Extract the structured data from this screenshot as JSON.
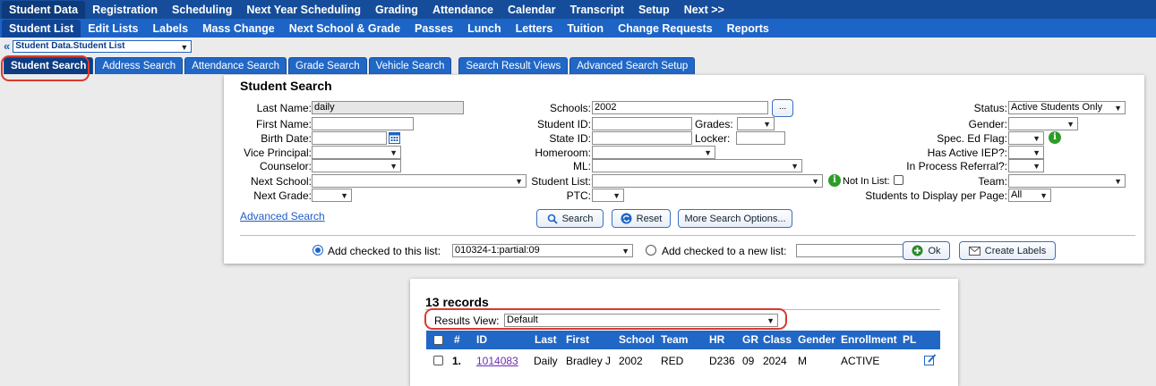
{
  "menu_primary": [
    {
      "label": "Student Data",
      "active": true
    },
    {
      "label": "Registration"
    },
    {
      "label": "Scheduling"
    },
    {
      "label": "Next Year Scheduling"
    },
    {
      "label": "Grading"
    },
    {
      "label": "Attendance"
    },
    {
      "label": "Calendar"
    },
    {
      "label": "Transcript"
    },
    {
      "label": "Setup"
    },
    {
      "label": "Next >>"
    }
  ],
  "menu_secondary": [
    {
      "label": "Student List",
      "active": true
    },
    {
      "label": "Edit Lists"
    },
    {
      "label": "Labels"
    },
    {
      "label": "Mass Change"
    },
    {
      "label": "Next School & Grade"
    },
    {
      "label": "Passes"
    },
    {
      "label": "Lunch"
    },
    {
      "label": "Letters"
    },
    {
      "label": "Tuition"
    },
    {
      "label": "Change Requests"
    },
    {
      "label": "Reports"
    }
  ],
  "breadcrumb": {
    "selected": "Student Data.Student List"
  },
  "tabs": [
    {
      "label": "Student Search",
      "active": true
    },
    {
      "label": "Address Search"
    },
    {
      "label": "Attendance Search"
    },
    {
      "label": "Grade Search"
    },
    {
      "label": "Vehicle Search"
    },
    {
      "label": "Search Result Views"
    },
    {
      "label": "Advanced Search Setup"
    }
  ],
  "search": {
    "title": "Student Search",
    "last_name_label": "Last Name:",
    "last_name_value": "daily",
    "first_name_label": "First Name:",
    "birth_date_label": "Birth Date:",
    "vice_principal_label": "Vice Principal:",
    "counselor_label": "Counselor:",
    "next_school_label": "Next School:",
    "next_grade_label": "Next Grade:",
    "schools_label": "Schools:",
    "schools_value": "2002",
    "schools_more": "...",
    "student_id_label": "Student ID:",
    "grades_label": "Grades:",
    "state_id_label": "State ID:",
    "locker_label": "Locker:",
    "homeroom_label": "Homeroom:",
    "ml_label": "ML:",
    "student_list_label": "Student List:",
    "not_in_list_label": "Not In List:",
    "ptc_label": "PTC:",
    "status_label": "Status:",
    "status_value": "Active Students Only",
    "gender_label": "Gender:",
    "sped_label": "Spec. Ed Flag:",
    "iep_label": "Has Active IEP?:",
    "referral_label": "In Process Referral?:",
    "team_label": "Team:",
    "per_page_label": "Students to Display per Page:",
    "per_page_value": "All",
    "advanced_link": "Advanced Search",
    "search_button": "Search",
    "reset_button": "Reset",
    "more_options_button": "More Search Options...",
    "add_checked_label": "Add checked to this list:",
    "add_checked_value": "010324-1:partial:09",
    "add_new_label": "Add checked to a new list:",
    "ok_button": "Ok",
    "labels_button": "Create Labels"
  },
  "results": {
    "title": "13 records",
    "view_label": "Results View:",
    "view_value": "Default",
    "columns": [
      "#",
      "ID",
      "Last",
      "First",
      "School",
      "Team",
      "HR",
      "GR",
      "Class",
      "Gender",
      "Enrollment",
      "PL"
    ],
    "rows": [
      {
        "num": "1.",
        "id": "1014083",
        "last": "Daily",
        "first": "Bradley J",
        "school": "2002",
        "team": "RED",
        "hr": "D236",
        "gr": "09",
        "class": "2024",
        "gender": "M",
        "enrollment": "ACTIVE"
      }
    ]
  }
}
